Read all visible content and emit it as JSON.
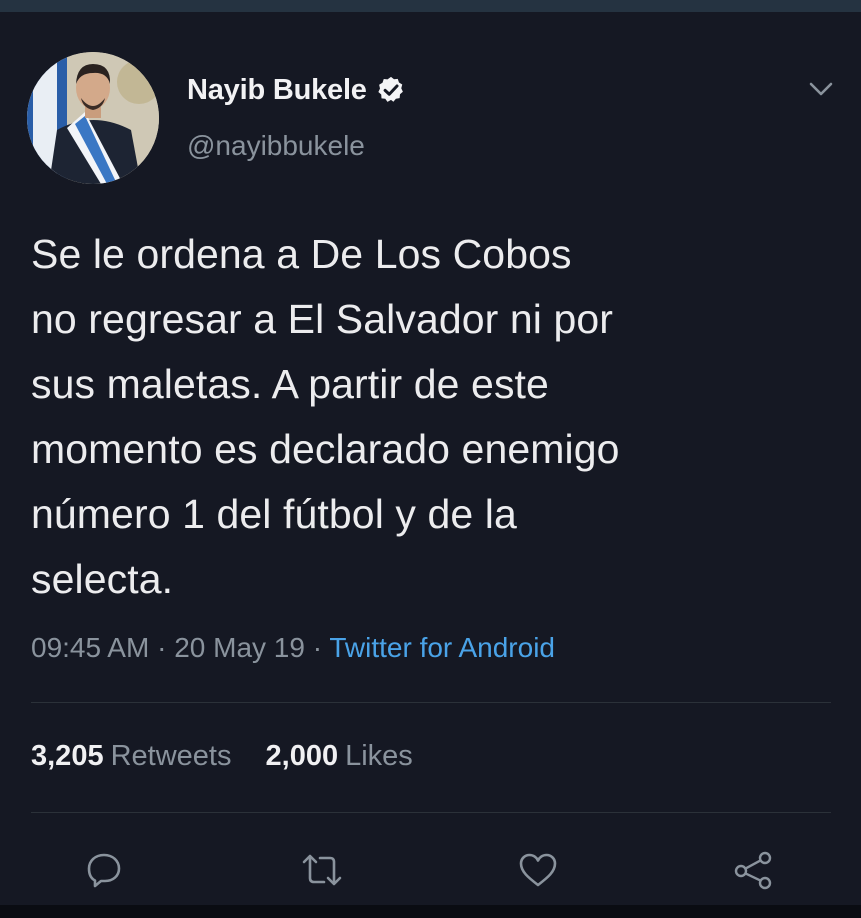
{
  "tweet": {
    "author": {
      "display_name": "Nayib Bukele",
      "handle": "@nayibbukele",
      "verified_icon": "verified-badge-icon"
    },
    "text": "Se le ordena a De Los Cobos\nno regresar a El Salvador ni por\nsus maletas. A partir de este\nmomento es declarado enemigo\nnúmero 1 del fútbol y de la\nselecta.",
    "time": "09:45 AM",
    "separator": " · ",
    "date": "20 May 19",
    "source": "Twitter for Android",
    "stats": {
      "retweets_count": "3,205",
      "retweets_label": "Retweets",
      "likes_count": "2,000",
      "likes_label": "Likes"
    },
    "actions": [
      "reply-icon",
      "retweet-icon",
      "like-icon",
      "share-icon"
    ]
  },
  "colors": {
    "background": "#151823",
    "link": "#4aa3e8",
    "muted": "#8a939d",
    "text": "#ececee"
  }
}
